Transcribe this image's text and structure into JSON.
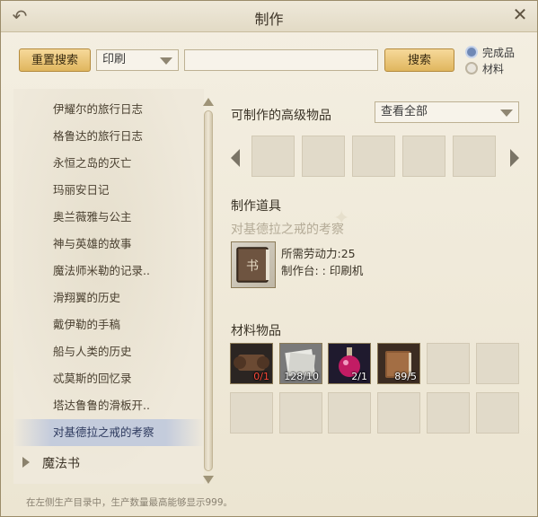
{
  "window": {
    "title": "制作"
  },
  "toolbar": {
    "reset_label": "重置搜索",
    "filter_value": "印刷",
    "search_value": "",
    "search_label": "搜索"
  },
  "radio": {
    "finished_label": "完成品",
    "material_label": "材料",
    "selected": "完成品"
  },
  "list": {
    "items": [
      "伊耀尔的旅行日志",
      "格鲁达的旅行日志",
      "永恒之岛的灭亡",
      "玛丽安日记",
      "奥兰薇雅与公主",
      "神与英雄的故事",
      "魔法师米勒的记录..",
      "滑翔翼的历史",
      "戴伊勒的手稿",
      "船与人类的历史",
      "忒莫斯的回忆录",
      "塔达鲁鲁的滑板开..",
      "对基德拉之戒的考察"
    ],
    "selected_index": 12,
    "category": "魔法书"
  },
  "advanced": {
    "label": "可制作的高级物品",
    "dropdown_value": "查看全部"
  },
  "tool": {
    "label": "制作道具",
    "item_name": "对基德拉之戒的考察",
    "labor": "所需劳动力:25",
    "station": "制作台: : 印刷机"
  },
  "materials": {
    "label": "材料物品",
    "items": [
      {
        "icon": "scroll-icon",
        "count": "0/1",
        "insufficient": true
      },
      {
        "icon": "paper-icon",
        "count": "128/10",
        "insufficient": false
      },
      {
        "icon": "potion-icon",
        "count": "2/1",
        "insufficient": false
      },
      {
        "icon": "leather-book-icon",
        "count": "89/5",
        "insufficient": false
      }
    ]
  },
  "footer": "在左侧生产目录中，生产数量最高能够显示999。",
  "colors": {
    "accent_button": "#e0b65e",
    "selected_row": "#c2cadc",
    "insufficient": "#ff4a3a"
  }
}
